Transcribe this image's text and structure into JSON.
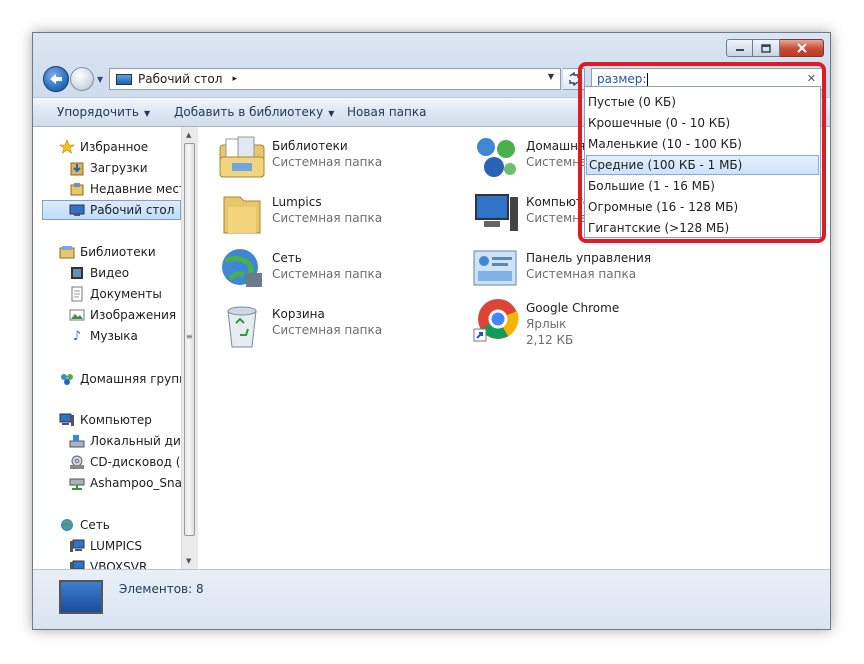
{
  "window": {
    "caption_buttons": {
      "minimize": "minimize",
      "maximize": "maximize",
      "close": "close"
    }
  },
  "address": {
    "location": "Рабочий стол",
    "separator": "▸"
  },
  "search": {
    "query": "размер:"
  },
  "toolbar": {
    "organize": "Упорядочить",
    "add_to_library": "Добавить в библиотеку",
    "new_folder": "Новая папка"
  },
  "sidebar": {
    "items": [
      {
        "label": "Избранное",
        "icon": "star-icon"
      },
      {
        "label": "Загрузки",
        "icon": "downloads-icon"
      },
      {
        "label": "Недавние места",
        "icon": "recent-places-icon"
      },
      {
        "label": "Рабочий стол",
        "icon": "desktop-icon"
      },
      {
        "label": "Библиотеки",
        "icon": "libraries-icon"
      },
      {
        "label": "Видео",
        "icon": "video-icon"
      },
      {
        "label": "Документы",
        "icon": "documents-icon"
      },
      {
        "label": "Изображения",
        "icon": "pictures-icon"
      },
      {
        "label": "Музыка",
        "icon": "music-icon"
      },
      {
        "label": "Домашняя группа",
        "icon": "homegroup-icon"
      },
      {
        "label": "Компьютер",
        "icon": "computer-icon"
      },
      {
        "label": "Локальный диск",
        "icon": "local-disk-icon"
      },
      {
        "label": "CD-дисковод (D:",
        "icon": "cd-drive-icon"
      },
      {
        "label": "Ashampoo_Snap",
        "icon": "network-drive-icon"
      },
      {
        "label": "Сеть",
        "icon": "network-icon"
      },
      {
        "label": "LUMPICS",
        "icon": "network-computer-icon"
      },
      {
        "label": "VBOXSVR",
        "icon": "network-computer-icon"
      }
    ]
  },
  "files": [
    {
      "name": "Библиотеки",
      "type": "Системная папка",
      "icon": "libraries-folder-icon"
    },
    {
      "name": "Домашняя группа",
      "type": "Системная папка",
      "icon": "homegroup-icon"
    },
    {
      "name": "Lumpics",
      "type": "Системная папка",
      "icon": "user-folder-icon"
    },
    {
      "name": "Компьютер",
      "type": "Системная папка",
      "icon": "computer-icon"
    },
    {
      "name": "Сеть",
      "type": "Системная папка",
      "icon": "network-globe-icon"
    },
    {
      "name": "Панель управления",
      "type": "Системная папка",
      "icon": "control-panel-icon"
    },
    {
      "name": "Корзина",
      "type": "Системная папка",
      "icon": "recycle-bin-icon"
    },
    {
      "name": "Google Chrome",
      "type": "Ярлык",
      "size": "2,12 КБ",
      "icon": "chrome-icon"
    }
  ],
  "status": {
    "count": "Элементов: 8"
  },
  "size_filter": {
    "options": [
      "Пустые (0 КБ)",
      "Крошечные (0 - 10 КБ)",
      "Маленькие (10 - 100 КБ)",
      "Средние (100 КБ - 1 МБ)",
      "Большие (1 - 16 МБ)",
      "Огромные (16 - 128 МБ)",
      "Гигантские (>128 МБ)"
    ],
    "highlighted_index": 3
  },
  "colors": {
    "highlight_frame": "#e01b24",
    "selection": "#cfe2fb"
  }
}
